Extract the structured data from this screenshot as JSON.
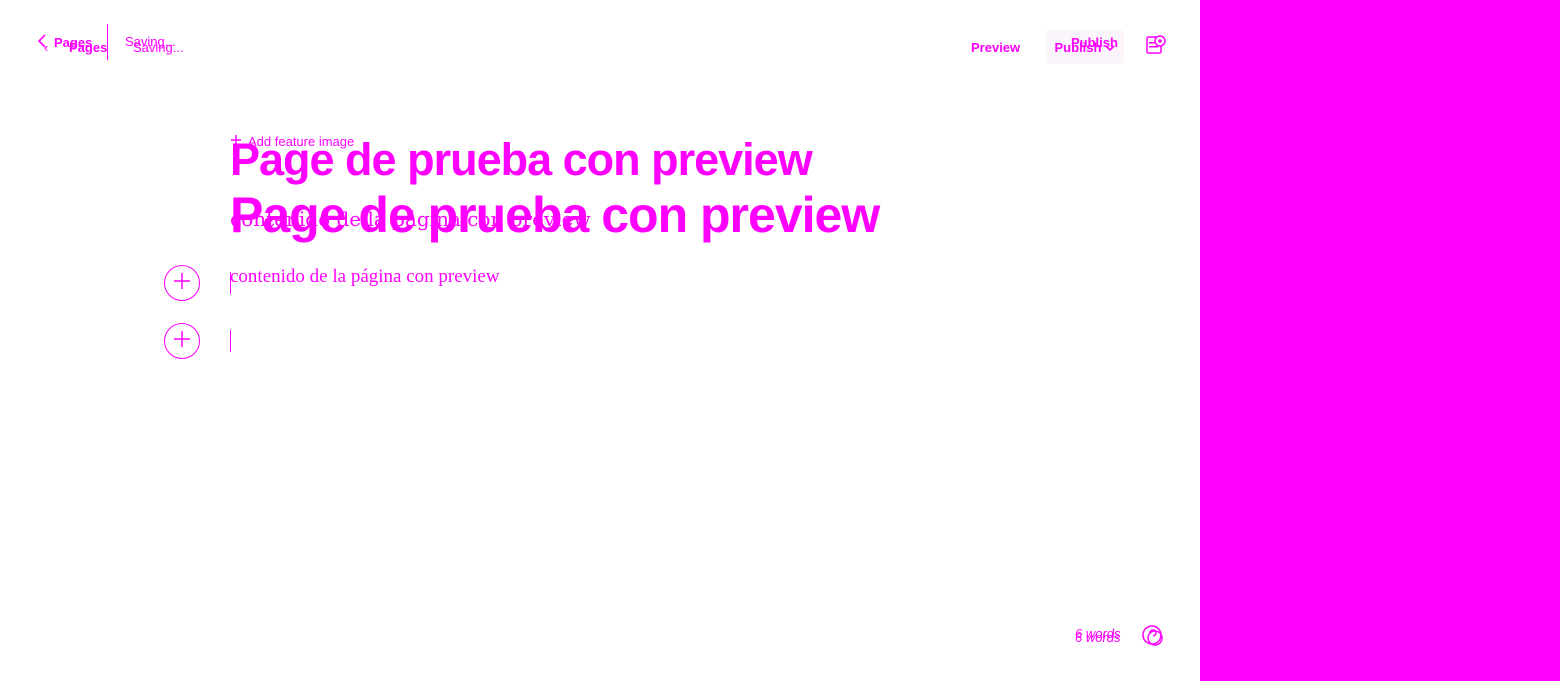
{
  "nav": {
    "back_label": "Pages",
    "status": "Saving..."
  },
  "ghost": {
    "back_label": "Pages",
    "status": "Saving...",
    "publish_label": "Publish",
    "word_count": "6 words"
  },
  "toolbar": {
    "preview_label": "Preview",
    "publish_label": "Publish"
  },
  "editor": {
    "feature_image_label": "Add feature image",
    "title": "Page de prueba con preview",
    "body": "contenido de la página con preview"
  },
  "footer": {
    "word_count": "6 words"
  },
  "colors": {
    "accent": "#ff00ff",
    "background": "#ffffff"
  },
  "icons": [
    "chevron-left-icon",
    "chevron-down-icon",
    "settings-panel-icon",
    "plus-icon",
    "help-icon"
  ]
}
